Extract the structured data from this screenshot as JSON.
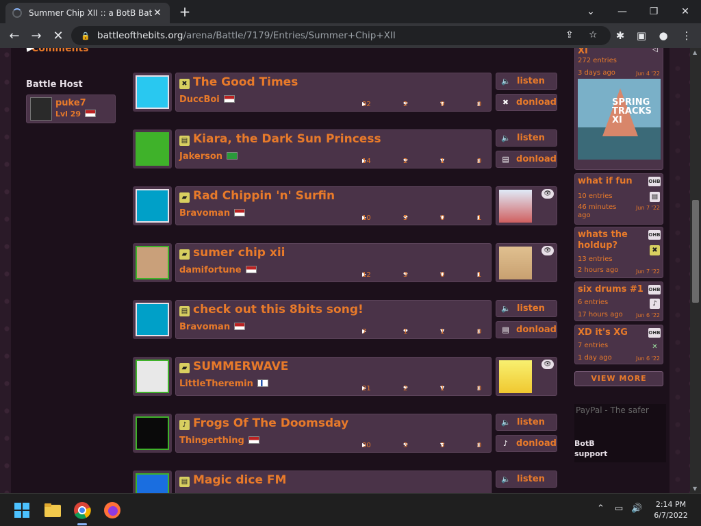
{
  "browser": {
    "tab_title": "Summer Chip XII :: a BotB Battle",
    "url_host": "battleofthebits.org",
    "url_path": "/arena/Battle/7179/Entries/Summer+Chip+XII"
  },
  "page": {
    "comments_link": "Comments",
    "battle_host_label": "Battle Host",
    "host": {
      "name": "puke7",
      "level": "Lvl 29"
    }
  },
  "entries": [
    {
      "title": "The Good Times",
      "author": "DuccBoi",
      "plays": "32",
      "favs": "2",
      "downs": "9",
      "comments": "0",
      "listen": "listen",
      "download": "donload",
      "fmt": "✖"
    },
    {
      "title": "Kiara, the Dark Sun Princess",
      "author": "Jakerson",
      "plays": "14",
      "favs": "2",
      "downs": "1",
      "comments": "0",
      "listen": "listen",
      "download": "donload",
      "fmt": "▤"
    },
    {
      "title": "Rad Chippin 'n' Surfin",
      "author": "Bravoman",
      "plays": "10",
      "favs": "5",
      "downs": "0",
      "comments": "1",
      "fmt": "▰"
    },
    {
      "title": "sumer chip xii",
      "author": "damifortune",
      "plays": "12",
      "favs": "3",
      "downs": "0",
      "comments": "1",
      "fmt": "▰"
    },
    {
      "title": "check out this 8bits song!",
      "author": "Bravoman",
      "plays": "7",
      "favs": "1",
      "downs": "1",
      "comments": "0",
      "listen": "listen",
      "download": "donload",
      "fmt": "▤"
    },
    {
      "title": "SUMMERWAVE",
      "author": "LittleTheremin",
      "plays": "21",
      "favs": "2",
      "downs": "1",
      "comments": "0",
      "fmt": "▰"
    },
    {
      "title": "Frogs Of The Doomsday",
      "author": "Thingerthing",
      "plays": "30",
      "favs": "3",
      "downs": "3",
      "comments": "0",
      "listen": "listen",
      "download": "donload",
      "fmt": "♪"
    },
    {
      "title": "Magic dice FM",
      "listen": "listen",
      "fmt": "▤"
    }
  ],
  "sidebar": {
    "battles": [
      {
        "name": "XI",
        "entries": "272 entries",
        "ago": "3 days ago",
        "date": "Jun 4 '22"
      },
      {
        "name": "what if fun",
        "entries": "10 entries",
        "ago": "46 minutes ago",
        "date": "Jun 7 '22",
        "badge": "OHB"
      },
      {
        "name": "whats the holdup?",
        "entries": "13 entries",
        "ago": "2 hours ago",
        "date": "Jun 7 '22",
        "badge": "OHB"
      },
      {
        "name": "six drums #1",
        "entries": "6 entries",
        "ago": "17 hours ago",
        "date": "Jun 6 '22",
        "badge": "OHB"
      },
      {
        "name": "XD it's XG",
        "entries": "7 entries",
        "ago": "1 day ago",
        "date": "Jun 6 '22",
        "badge": "OHB"
      }
    ],
    "view_more": "VIEW MORE",
    "paypal_alt": "PayPal - The safer",
    "support": "BotB support"
  },
  "taskbar": {
    "time": "2:14 PM",
    "date": "6/7/2022"
  },
  "colors": {
    "accent": "#e87a2a",
    "panel": "#4a3348",
    "page_bg": "#1c101b"
  }
}
